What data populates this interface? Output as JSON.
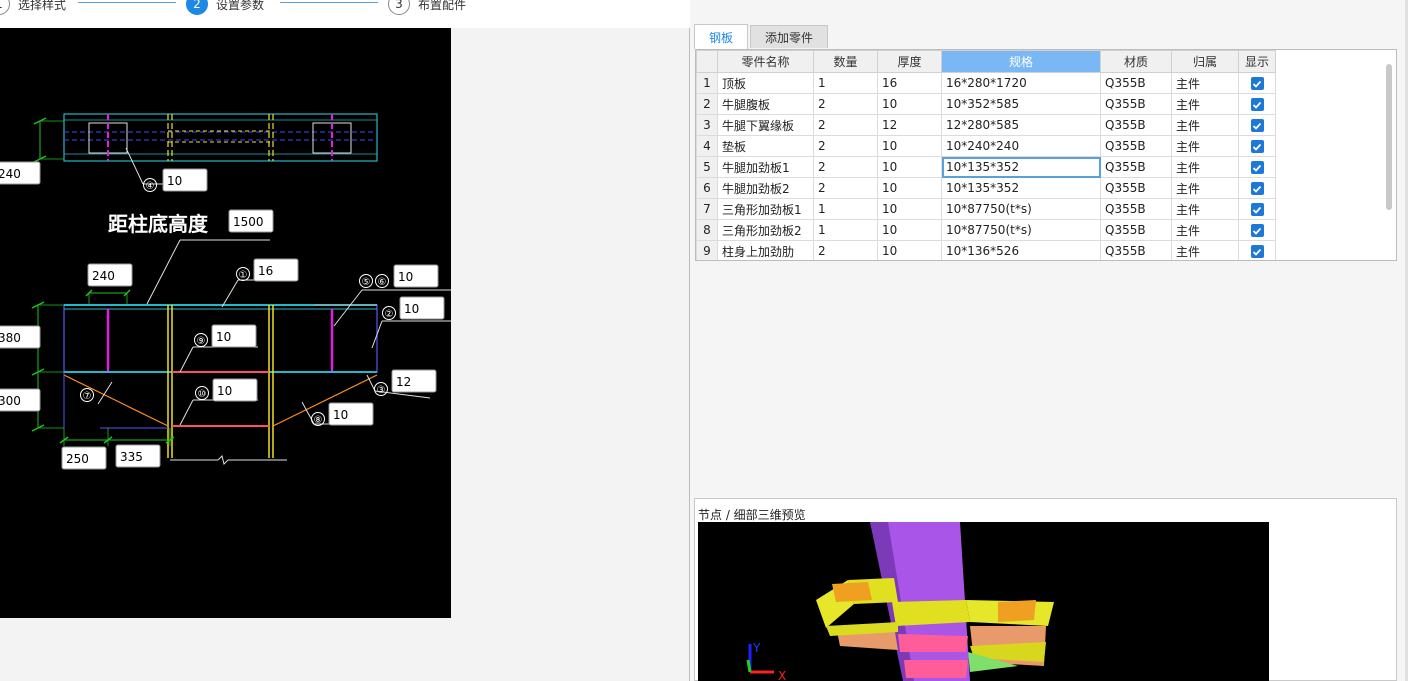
{
  "steps": [
    {
      "num": "1",
      "label": "选择样式",
      "active": false
    },
    {
      "num": "2",
      "label": "设置参数",
      "active": true
    },
    {
      "num": "3",
      "label": "布置配件",
      "active": false
    }
  ],
  "drawing": {
    "title": "距柱底高度",
    "inputs": {
      "height_from_base": "1500",
      "top_width": "240",
      "plate_240": "240",
      "p4": "10",
      "p1": "16",
      "p56": "10",
      "p2": "10",
      "p9": "10",
      "p10": "10",
      "p3": "12",
      "p8": "10",
      "h380": "380",
      "h300": "300",
      "w250": "250",
      "w335": "335"
    },
    "markers": {
      "m1": "①",
      "m2": "②",
      "m3": "③",
      "m4": "④",
      "m5": "⑤",
      "m6": "⑥",
      "m7": "⑦",
      "m8": "⑧",
      "m9": "⑨",
      "m10": "⑩"
    }
  },
  "tabs": [
    "钢板",
    "添加零件"
  ],
  "table": {
    "columns": [
      "零件名称",
      "数量",
      "厚度",
      "规格",
      "材质",
      "归属",
      "显示"
    ],
    "rows": [
      {
        "no": "1",
        "name": "顶板",
        "qty": "1",
        "thk": "16",
        "spec": "16*280*1720",
        "mat": "Q355B",
        "owner": "主件",
        "show": true
      },
      {
        "no": "2",
        "name": "牛腿腹板",
        "qty": "2",
        "thk": "10",
        "spec": "10*352*585",
        "mat": "Q355B",
        "owner": "主件",
        "show": true
      },
      {
        "no": "3",
        "name": "牛腿下翼缘板",
        "qty": "2",
        "thk": "12",
        "spec": "12*280*585",
        "mat": "Q355B",
        "owner": "主件",
        "show": true
      },
      {
        "no": "4",
        "name": "垫板",
        "qty": "2",
        "thk": "10",
        "spec": "10*240*240",
        "mat": "Q355B",
        "owner": "主件",
        "show": true
      },
      {
        "no": "5",
        "name": "牛腿加劲板1",
        "qty": "2",
        "thk": "10",
        "spec": "10*135*352",
        "mat": "Q355B",
        "owner": "主件",
        "show": true
      },
      {
        "no": "6",
        "name": "牛腿加劲板2",
        "qty": "2",
        "thk": "10",
        "spec": "10*135*352",
        "mat": "Q355B",
        "owner": "主件",
        "show": true
      },
      {
        "no": "7",
        "name": "三角形加劲板1",
        "qty": "1",
        "thk": "10",
        "spec": "10*87750(t*s)",
        "mat": "Q355B",
        "owner": "主件",
        "show": true
      },
      {
        "no": "8",
        "name": "三角形加劲板2",
        "qty": "1",
        "thk": "10",
        "spec": "10*87750(t*s)",
        "mat": "Q355B",
        "owner": "主件",
        "show": true
      },
      {
        "no": "9",
        "name": "柱身上加劲肋",
        "qty": "2",
        "thk": "10",
        "spec": "10*136*526",
        "mat": "Q355B",
        "owner": "主件",
        "show": true
      }
    ]
  },
  "preview": {
    "title": "节点 / 细部三维预览",
    "axis_y": "Y",
    "axis_x": "X"
  },
  "colors": {
    "accent": "#1e88e5",
    "header_selected": "#7ab8f5",
    "canvas_bg": "#000000"
  }
}
